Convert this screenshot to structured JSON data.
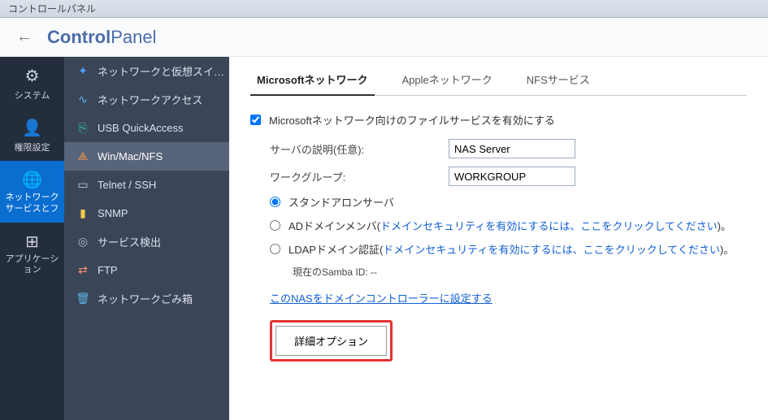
{
  "window": {
    "title": "コントロールパネル"
  },
  "header": {
    "title_strong": "Control",
    "title_light": "Panel"
  },
  "primary_nav": [
    {
      "label": "システム",
      "icon": "⚙",
      "active": false
    },
    {
      "label": "権限設定",
      "icon": "👤",
      "active": false
    },
    {
      "label": "ネットワークサービスとフ",
      "icon": "🌐",
      "active": true
    },
    {
      "label": "アプリケーション",
      "icon": "⊞",
      "active": false
    }
  ],
  "secondary_nav": [
    {
      "label": "ネットワークと仮想スイ…",
      "icon": "✦",
      "color": "#4aa3ff"
    },
    {
      "label": "ネットワークアクセス",
      "icon": "∿",
      "color": "#58b4ff"
    },
    {
      "label": "USB QuickAccess",
      "icon": "⎘",
      "color": "#2ec7b0"
    },
    {
      "label": "Win/Mac/NFS",
      "icon": "⟁",
      "color": "#f79b42",
      "active": true
    },
    {
      "label": "Telnet / SSH",
      "icon": "▭",
      "color": "#bfc6d2"
    },
    {
      "label": "SNMP",
      "icon": "▮",
      "color": "#f4c64c"
    },
    {
      "label": "サービス検出",
      "icon": "◎",
      "color": "#b7bfcc"
    },
    {
      "label": "FTP",
      "icon": "⇄",
      "color": "#ff8f7a"
    },
    {
      "label": "ネットワークごみ箱",
      "icon": "🗑",
      "color": "#5db4e6"
    }
  ],
  "tabs": [
    {
      "label": "Microsoftネットワーク",
      "active": true
    },
    {
      "label": "Appleネットワーク",
      "active": false
    },
    {
      "label": "NFSサービス",
      "active": false
    }
  ],
  "panel": {
    "enable_label": "Microsoftネットワーク向けのファイルサービスを有効にする",
    "server_desc_label": "サーバの説明(任意):",
    "server_desc_value": "NAS Server",
    "workgroup_label": "ワークグループ:",
    "workgroup_value": "WORKGROUP",
    "radio_standalone": "スタンドアロンサーバ",
    "radio_ad_prefix": "ADドメインメンバ(",
    "radio_ad_link": "ドメインセキュリティを有効にするには、ここをクリックしてください",
    "radio_ad_suffix": ")。",
    "radio_ldap_prefix": "LDAPドメイン認証(",
    "radio_ldap_link": "ドメインセキュリティを有効にするには、ここをクリックしてください",
    "radio_ldap_suffix": ")。",
    "samba_id_label": "現在のSamba ID: --",
    "dc_link": "このNASをドメインコントローラーに設定する",
    "advanced_button": "詳細オプション"
  }
}
